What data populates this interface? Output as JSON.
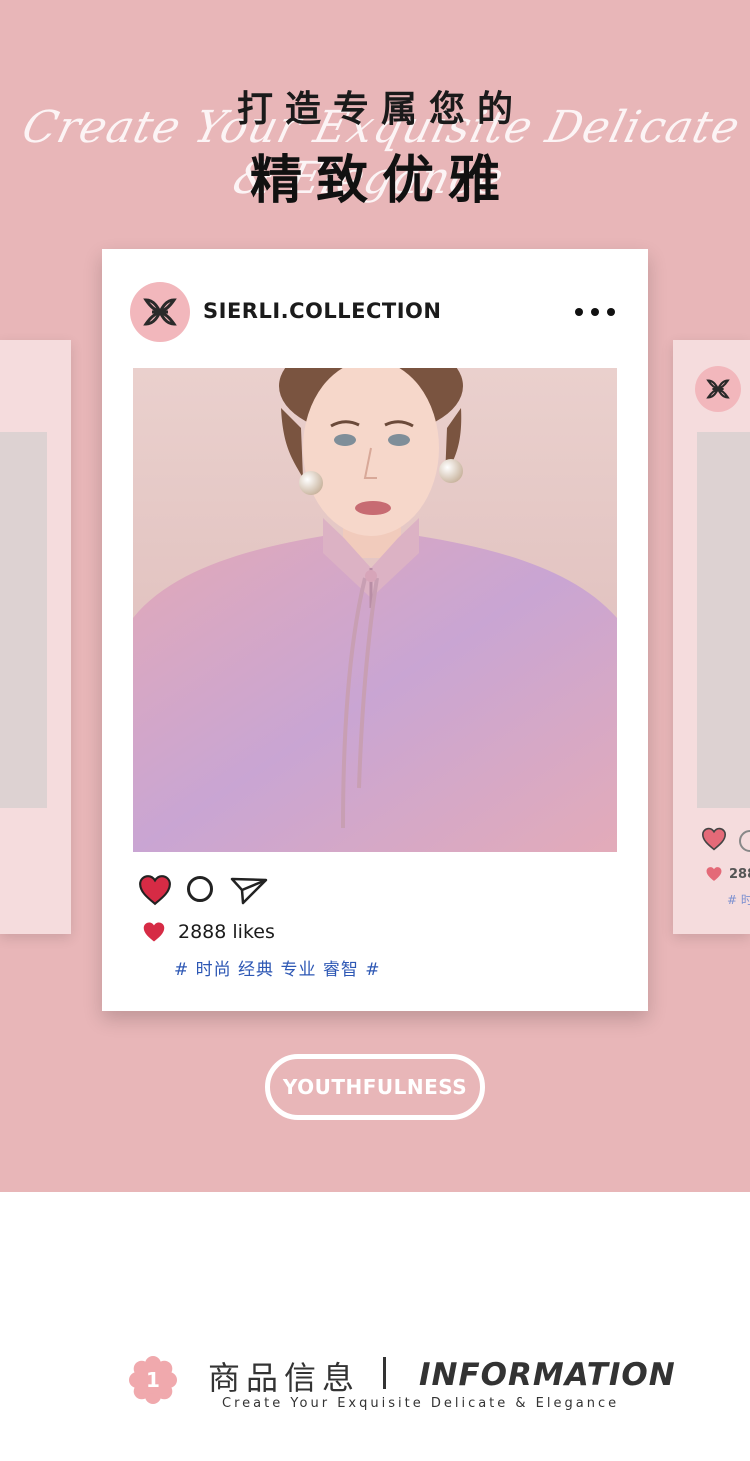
{
  "hero": {
    "title_top": "打造专属您的",
    "script_line": "Create Your Exquisite Delicate & Elegance",
    "title_main": "精致优雅"
  },
  "post": {
    "account_name": "SIERLI.COLLECTION",
    "more_icon": "more-dots-icon",
    "likes": "2888 likes",
    "tags": "# 时尚 经典 专业 睿智 #",
    "icons": [
      "heart-icon",
      "comment-icon",
      "share-icon"
    ]
  },
  "side_card_right": {
    "likes_partial": "288",
    "tags_partial": "# 时"
  },
  "cta": {
    "label": "YOUTHFULNESS"
  },
  "section": {
    "number": "1",
    "title_cn": "商品信息",
    "title_en": "INFORMATION",
    "subtitle": "Create Your Exquisite Delicate & Elegance"
  },
  "colors": {
    "hero_bg": "#e8b6b8",
    "brand_pink": "#f2b7bc",
    "heart_red": "#d62b45",
    "tag_blue": "#2d57b4"
  }
}
